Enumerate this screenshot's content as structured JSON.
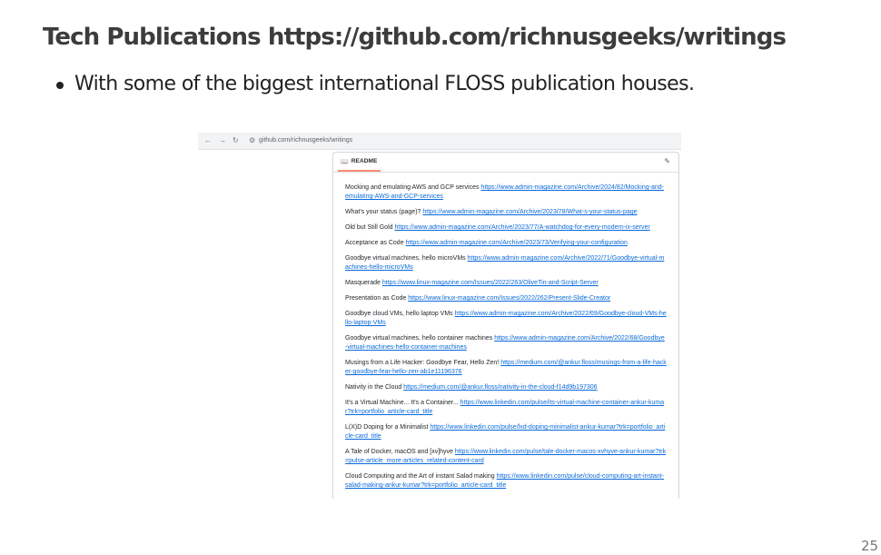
{
  "slide": {
    "title": "Tech Publications https://github.com/richnusgeeks/writings",
    "bullets": [
      "With some of the biggest international FLOSS publication houses."
    ],
    "page_number": "25"
  },
  "browser": {
    "url": "github.com/richnusgeeks/writings",
    "icons": {
      "back": "←",
      "forward": "→",
      "reload": "↻",
      "site_settings": "⚙"
    }
  },
  "readme": {
    "tab_label": "README",
    "icons": {
      "book": "📖",
      "edit": "✎"
    },
    "publications": [
      {
        "title": "Mocking and emulating AWS and GCP services",
        "url": "https://www.admin-magazine.com/Archive/2024/82/Mocking-and-emulating-AWS-and-GCP-services"
      },
      {
        "title": "What's your status (page)?",
        "url": "https://www.admin-magazine.com/Archive/2023/78/What-s-your-status-page"
      },
      {
        "title": "Old but Still Gold",
        "url": "https://www.admin-magazine.com/Archive/2023/77/A-watchdog-for-every-modern-ix-server"
      },
      {
        "title": "Acceptance as Code",
        "url": "https://www.admin-magazine.com/Archive/2023/73/Verifying-your-configuration"
      },
      {
        "title": "Goodbye virtual machines, hello microVMs",
        "url": "https://www.admin-magazine.com/Archive/2022/71/Goodbye-virtual-machines-hello-microVMs"
      },
      {
        "title": "Masquerade",
        "url": "https://www.linux-magazine.com/Issues/2022/263/OliveTin-and-Script-Server"
      },
      {
        "title": "Presentation as Code",
        "url": "https://www.linux-magazine.com/Issues/2022/262/Present-Slide-Creator"
      },
      {
        "title": "Goodbye cloud VMs, hello laptop VMs",
        "url": "https://www.admin-magazine.com/Archive/2022/69/Goodbye-cloud-VMs-hello-laptop-VMs"
      },
      {
        "title": "Goodbye virtual machines, hello container machines",
        "url": "https://www.admin-magazine.com/Archive/2022/68/Goodbye-virtual-machines-hello-container-machines"
      },
      {
        "title": "Musings from a Life Hacker: Goodbye Fear, Hello Zen!",
        "url": "https://medium.com/@ankur.floss/musings-from-a-life-hacker-goodbye-fear-hello-zen-ab1e11196376"
      },
      {
        "title": "Nativity in the Cloud",
        "url": "https://medium.com/@ankur.floss/nativity-in-the-cloud-f14d9b197306"
      },
      {
        "title": "It's a Virtual Machine... It's a Container...",
        "url": "https://www.linkedin.com/pulse/its-virtual-machine-container-ankur-kumar?trk=portfolio_article-card_title"
      },
      {
        "title": "L(X)D Doping for a Minimalist",
        "url": "https://www.linkedin.com/pulse/lxd-doping-minimalist-ankur-kumar?trk=portfolio_article-card_title"
      },
      {
        "title": "A Tale of Docker, macOS and [xv]hyve",
        "url": "https://www.linkedin.com/pulse/tale-docker-macos-xvhyve-ankur-kumar?trk=pulse-article_more-articles_related-content-card"
      },
      {
        "title": "Cloud Computing and the Art of instant Salad making",
        "url": "https://www.linkedin.com/pulse/cloud-computing-art-instant-salad-making-ankur-kumar?trk=portfolio_article-card_title"
      }
    ]
  }
}
